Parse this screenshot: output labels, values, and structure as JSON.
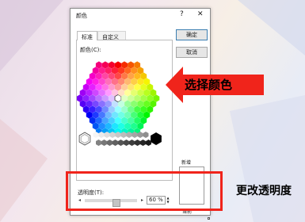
{
  "dialog": {
    "title": "颜色",
    "help": "?",
    "close": "✕",
    "tabs": [
      {
        "label": "标准",
        "active": true
      },
      {
        "label": "自定义",
        "active": false
      }
    ],
    "colors_label": "颜色(C):",
    "ok_button": "确定",
    "cancel_button": "取消",
    "new_label": "新增",
    "current_label": "当前",
    "transparency_label": "透明度(T):",
    "transparency_value": "60 %",
    "transparency_fraction": 0.6,
    "slider_left": "◂",
    "slider_right": "▸",
    "spin_up": "▲",
    "spin_down": "▼"
  },
  "annotations": {
    "choose_color": "选择颜色",
    "change_transparency": "更改透明度"
  },
  "colors": {
    "accent_red": "#f0241b",
    "ok_border": "#3c7fb1"
  },
  "icons": {
    "arrow": "red-arrow-icon",
    "hex_palette": "color-hexagon"
  }
}
